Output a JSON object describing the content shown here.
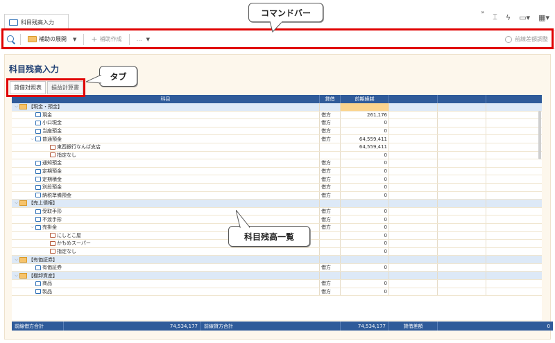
{
  "window_tab": "科目残高入力",
  "toolbar_right_more": "»",
  "command_bar": {
    "expand_label": "補助の展開",
    "create_sub_label": "補助作成",
    "more_label": "…",
    "prev_adjust_label": "前線差額調整"
  },
  "callouts": {
    "command_bar": "コマンドバー",
    "tab": "タブ",
    "list": "科目残高一覧"
  },
  "page_title": "科目残高入力",
  "tabs": [
    "貸借対照表",
    "損益計算書"
  ],
  "table": {
    "headers": [
      "科目",
      "貸借",
      "前期繰越"
    ],
    "rows": [
      {
        "kind": "group",
        "label": "【現金・預金】",
        "type": "",
        "bal": ""
      },
      {
        "kind": "acc",
        "label": "現金",
        "type": "借方",
        "bal": "261,176"
      },
      {
        "kind": "acc",
        "label": "小口現金",
        "type": "借方",
        "bal": "0"
      },
      {
        "kind": "acc",
        "label": "当座預金",
        "type": "借方",
        "bal": "0"
      },
      {
        "kind": "accx",
        "label": "普通預金",
        "type": "借方",
        "bal": "64,559,411"
      },
      {
        "kind": "sub",
        "label": "東西銀行なんば支店",
        "type": "",
        "bal": "64,559,411"
      },
      {
        "kind": "sub",
        "label": "指定なし",
        "type": "",
        "bal": "0"
      },
      {
        "kind": "acc",
        "label": "通知預金",
        "type": "借方",
        "bal": "0"
      },
      {
        "kind": "acc",
        "label": "定期預金",
        "type": "借方",
        "bal": "0"
      },
      {
        "kind": "acc",
        "label": "定期積金",
        "type": "借方",
        "bal": "0"
      },
      {
        "kind": "acc",
        "label": "別段預金",
        "type": "借方",
        "bal": "0"
      },
      {
        "kind": "acc",
        "label": "納税準備預金",
        "type": "借方",
        "bal": "0"
      },
      {
        "kind": "group",
        "label": "【売上債権】",
        "type": "",
        "bal": ""
      },
      {
        "kind": "acc",
        "label": "受取手形",
        "type": "借方",
        "bal": "0"
      },
      {
        "kind": "acc",
        "label": "不渡手形",
        "type": "借方",
        "bal": "0"
      },
      {
        "kind": "accx",
        "label": "売掛金",
        "type": "借方",
        "bal": "0"
      },
      {
        "kind": "sub",
        "label": "にしとこ屋",
        "type": "",
        "bal": "0"
      },
      {
        "kind": "sub",
        "label": "かもめスーパー",
        "type": "",
        "bal": "0"
      },
      {
        "kind": "sub",
        "label": "指定なし",
        "type": "",
        "bal": "0"
      },
      {
        "kind": "group",
        "label": "【有価証券】",
        "type": "",
        "bal": ""
      },
      {
        "kind": "acc",
        "label": "有価証券",
        "type": "借方",
        "bal": "0"
      },
      {
        "kind": "group",
        "label": "【棚卸資産】",
        "type": "",
        "bal": ""
      },
      {
        "kind": "acc",
        "label": "商品",
        "type": "借方",
        "bal": "0"
      },
      {
        "kind": "acc",
        "label": "製品",
        "type": "借方",
        "bal": "0"
      }
    ]
  },
  "footer": {
    "debit_label": "前線借方合計",
    "debit_value": "74,534,177",
    "credit_label": "前線貸方合計",
    "credit_value": "74,534,177",
    "diff_label": "貸借差額",
    "diff_value": "0"
  }
}
